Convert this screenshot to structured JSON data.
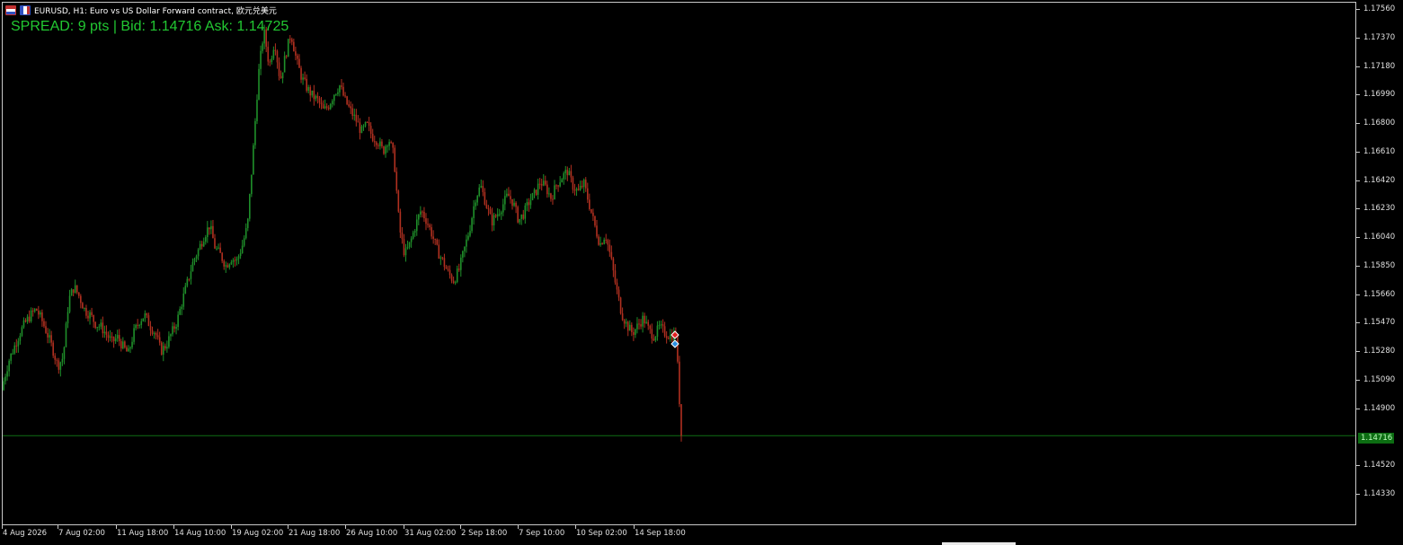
{
  "window": {
    "title": "EURUSD, H1:  Euro vs US Dollar Forward contract, 欧元兑美元",
    "icon_left": "chart-grid-icon",
    "icon_right": "chart-bars-icon"
  },
  "indicator": {
    "spread_text": "SPREAD: 9 pts  |  Bid: 1.14716  Ask: 1.14725",
    "color": "#22c832"
  },
  "colors": {
    "background": "#000000",
    "bull": "#1f8f2a",
    "bear": "#b03020",
    "bid_line": "#0f6e14",
    "bid_tag_bg": "#0c6d12"
  },
  "price_axis": {
    "labels": [
      "1.17560",
      "1.17370",
      "1.17180",
      "1.16990",
      "1.16800",
      "1.16610",
      "1.16420",
      "1.16230",
      "1.16040",
      "1.15850",
      "1.15660",
      "1.15470",
      "1.15280",
      "1.15090",
      "1.14900",
      "1.14520",
      "1.14330"
    ],
    "current_bid_label": "1.14716"
  },
  "time_axis": {
    "labels": [
      "4 Aug 2026",
      "7 Aug 02:00",
      "11 Aug 18:00",
      "14 Aug 10:00",
      "19 Aug 02:00",
      "21 Aug 18:00",
      "26 Aug 10:00",
      "31 Aug 02:00",
      "2 Sep 18:00",
      "7 Sep 10:00",
      "10 Sep 02:00",
      "14 Sep 18:00"
    ]
  },
  "chart_data": {
    "type": "candlestick",
    "symbol": "EURUSD",
    "timeframe": "H1",
    "ylim": [
      1.1424,
      1.1765
    ],
    "bid": 1.14716,
    "ask": 1.14725,
    "closes": [
      1.1508,
      1.1522,
      1.1531,
      1.154,
      1.1547,
      1.1552,
      1.1556,
      1.1549,
      1.154,
      1.153,
      1.1518,
      1.1524,
      1.1562,
      1.1571,
      1.1564,
      1.1555,
      1.1552,
      1.1546,
      1.1544,
      1.1539,
      1.1534,
      1.1537,
      1.1531,
      1.1526,
      1.154,
      1.1548,
      1.1552,
      1.1545,
      1.154,
      1.1528,
      1.1532,
      1.154,
      1.1548,
      1.1562,
      1.1575,
      1.1588,
      1.1596,
      1.1605,
      1.1612,
      1.1597,
      1.1592,
      1.1585,
      1.159,
      1.1588,
      1.1598,
      1.1612,
      1.166,
      1.1712,
      1.1742,
      1.1718,
      1.1735,
      1.1708,
      1.1725,
      1.174,
      1.1722,
      1.171,
      1.1703,
      1.1698,
      1.1695,
      1.1688,
      1.1692,
      1.17,
      1.1705,
      1.1695,
      1.1688,
      1.1682,
      1.1674,
      1.1679,
      1.1671,
      1.1668,
      1.1661,
      1.167,
      1.1658,
      1.161,
      1.1592,
      1.16,
      1.1612,
      1.1622,
      1.1615,
      1.1606,
      1.1595,
      1.1588,
      1.158,
      1.1575,
      1.1582,
      1.1596,
      1.161,
      1.163,
      1.1638,
      1.1626,
      1.1614,
      1.1619,
      1.1625,
      1.1632,
      1.1627,
      1.1615,
      1.162,
      1.1628,
      1.1633,
      1.1641,
      1.1637,
      1.163,
      1.1639,
      1.1644,
      1.1648,
      1.1638,
      1.1634,
      1.164,
      1.1626,
      1.1612,
      1.1599,
      1.1606,
      1.159,
      1.157,
      1.1553,
      1.1545,
      1.154,
      1.1545,
      1.155,
      1.1542,
      1.1538,
      1.1544,
      1.154,
      1.1538,
      1.154,
      1.1472
    ]
  }
}
